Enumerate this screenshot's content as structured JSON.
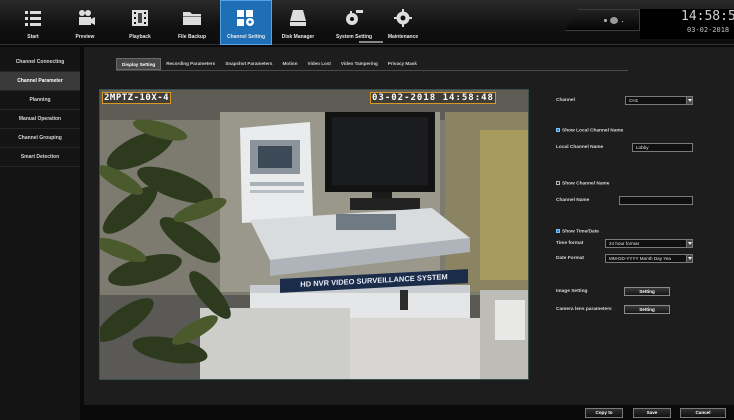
{
  "topbar": {
    "items": [
      {
        "label": "Start",
        "icon": "list-icon"
      },
      {
        "label": "Preview",
        "icon": "camera-icon"
      },
      {
        "label": "Playback",
        "icon": "film-icon"
      },
      {
        "label": "File Backup",
        "icon": "folder-icon"
      },
      {
        "label": "Channel Setting",
        "icon": "channel-setting-icon"
      },
      {
        "label": "Disk Manager",
        "icon": "disk-icon"
      },
      {
        "label": "System Setting",
        "icon": "gear-setting-icon"
      },
      {
        "label": "Maintenance",
        "icon": "maintenance-gear-icon"
      }
    ],
    "active_index": 4,
    "clock_time": "14:58:5",
    "clock_date": "03-02-2018"
  },
  "sidebar": {
    "items": [
      {
        "label": "Channel Connecting"
      },
      {
        "label": "Channel Parameter"
      },
      {
        "label": "Planning"
      },
      {
        "label": "Manual Operation"
      },
      {
        "label": "Channel Grouping"
      },
      {
        "label": "Smart Detection"
      }
    ],
    "active_index": 1
  },
  "tabs": [
    {
      "label": "Display Setting"
    },
    {
      "label": "Recording Parameters"
    },
    {
      "label": "Snapshot Parameters"
    },
    {
      "label": "Motion"
    },
    {
      "label": "Video Lost"
    },
    {
      "label": "Video Tampering"
    },
    {
      "label": "Privacy Mask"
    }
  ],
  "active_tab": 0,
  "preview": {
    "osd_name": "2MPTZ-10X-4",
    "osd_time": "03-02-2018 14:58:48",
    "sign_text": "HD NVR VIDEO SURVEILLANCE SYSTEM"
  },
  "settings": {
    "channel_label": "Channel",
    "channel_value": "CH1",
    "show_local_name_label": "Show Local Channel Name",
    "show_local_name_checked": true,
    "local_name_label": "Local Channel Name",
    "local_name_value": "Lobby",
    "show_channel_name_label": "Show Channel Name",
    "show_channel_name_checked": false,
    "channel_name_label": "Channel Name",
    "channel_name_value": "",
    "show_time_label": "Show Time/Date",
    "show_time_checked": true,
    "time_format_label": "Time format",
    "time_format_value": "24 hour format",
    "date_format_label": "Date Format",
    "date_format_value": "MM-DD-YYYY Month Day Yea",
    "image_setting_label": "Image Setting",
    "camera_lens_label": "Camera lens parameters",
    "setting_button": "Setting"
  },
  "footer": {
    "copy_to": "Copy to",
    "save": "Save",
    "cancel": "Cancel"
  },
  "colors": {
    "accent": "#1f6fb6",
    "osd_border": "#d89a22",
    "checkbox_on": "#2f86d6"
  }
}
